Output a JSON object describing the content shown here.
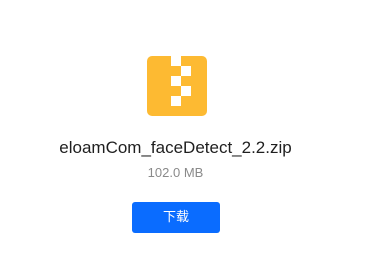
{
  "file": {
    "icon": "zip-archive-icon",
    "icon_color": "#FDBA32",
    "name": "eloamCom_faceDetect_2.2.zip",
    "size": "102.0 MB"
  },
  "actions": {
    "download_label": "下载",
    "download_color": "#0A6CFF"
  }
}
